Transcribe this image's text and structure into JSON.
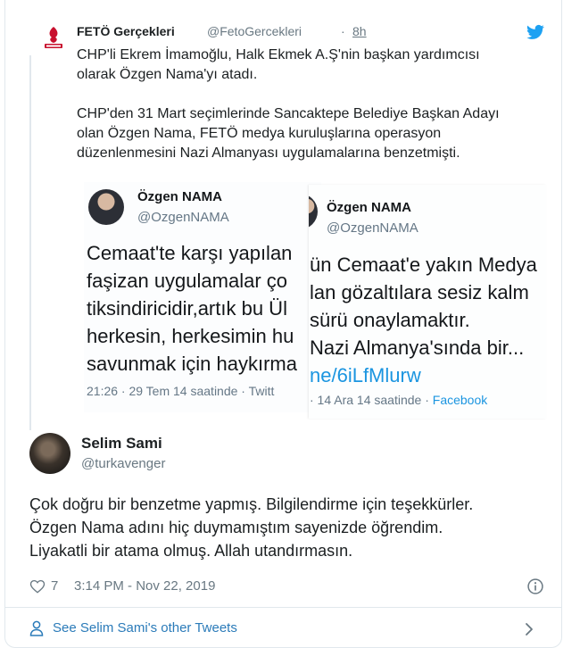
{
  "quoted_tweet": {
    "author_name": "FETÖ Gerçekleri",
    "handle": "@FetoGercekleri",
    "separator": "·",
    "time": "8h",
    "paragraph_1": "CHP'li Ekrem İmamoğlu, Halk Ekmek A.Ş'nin başkan yardımcısı\nolarak Özgen Nama'yı atadı.",
    "paragraph_2": "CHP'den 31 Mart seçimlerinde Sancaktepe Belediye Başkan Adayı\nolan Özgen Nama, FETÖ medya kuruluşlarına operasyon\ndüzenlenmesini Nazi Almanyası uygulamalarına benzetmişti.",
    "images": [
      {
        "name": "Özgen NAMA",
        "handle": "@OzgenNAMA",
        "lines": [
          "Cemaat'te karşı yapılan",
          "faşizan uygulamalar ço",
          "tiksindiricidir,artık bu Ül",
          "herkesin, herkesimin hu",
          "savunmak için haykırma"
        ],
        "meta": "21:26 · 29 Tem 14 saatinde · Twitt"
      },
      {
        "name": "Özgen NAMA",
        "handle": "@OzgenNAMA",
        "lines": [
          "ün Cemaat'e yakın Medya",
          "lan gözaltılara sesiz kalm",
          "sürü onaylamaktır.",
          "Nazi Almanya'sında bir..."
        ],
        "link": "ne/6iLfMlurw",
        "meta": "· 14 Ara 14 saatinde · ",
        "source": "Facebook"
      }
    ]
  },
  "tweet": {
    "author_name": "Selim Sami",
    "handle": "@turkavenger",
    "text": "Çok doğru bir benzetme yapmış. Bilgilendirme için teşekkürler.\nÖzgen Nama adını hiç duymamıştım sayenizde öğrendim.\nLiyakatli bir atama olmuş. Allah utandırmasın.",
    "likes": "7",
    "timestamp": "3:14 PM - Nov 22, 2019",
    "more_tweets_label": "See Selim Sami's other Tweets"
  },
  "icons": {
    "twitter": "twitter-bird-icon",
    "heart": "heart-icon",
    "info": "info-icon",
    "person": "person-icon",
    "chevron": "chevron-right-icon"
  },
  "colors": {
    "twitter_blue": "#1da1f2",
    "link_blue": "#2b7bb9",
    "secondary_text": "#697882",
    "logo_red": "#c8102e"
  }
}
